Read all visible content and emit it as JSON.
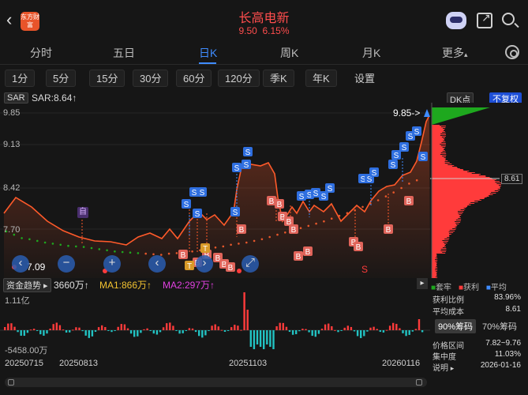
{
  "header": {
    "logo_text": "东方财富",
    "stock_name": "长高电新",
    "price": "9.50",
    "change_pct": "6.15%",
    "icons": [
      "back-arrow-icon",
      "ai-robot-icon",
      "share-icon",
      "search-icon"
    ]
  },
  "tabs": [
    "分时",
    "五日",
    "日K",
    "周K",
    "月K",
    "更多"
  ],
  "active_tab": "日K",
  "periods": [
    "1分",
    "5分",
    "15分",
    "30分",
    "60分",
    "120分",
    "季K",
    "年K",
    "设置"
  ],
  "indicator": {
    "name": "SAR",
    "value_label": "SAR:8.64↑",
    "dk_label": "DK点",
    "adjust_label": "不复权",
    "high_mark": "9.85->",
    "low_mark": "7.09",
    "price_tag": "8.61",
    "y_ticks": [
      "9.85",
      "9.13",
      "8.42",
      "7.70"
    ]
  },
  "colors": {
    "up": "#ff3b3b",
    "down": "#22c3c3",
    "accent": "#3f8cff",
    "sar_up": "#e6572b",
    "sar_down": "#1ea81e"
  },
  "chart_data": {
    "type": "line",
    "title": "SAR",
    "y_range": [
      6.98,
      9.85
    ],
    "series": [
      {
        "name": "SAR",
        "values": [
          7.72,
          7.66,
          7.6,
          7.58,
          7.55,
          7.52,
          7.5,
          7.48,
          7.46,
          7.45,
          7.44,
          7.42,
          7.4,
          7.38,
          7.36,
          7.35,
          7.34,
          7.33,
          7.32,
          7.31,
          7.3,
          7.32,
          7.33,
          7.35,
          7.36,
          7.38,
          7.4,
          7.43,
          7.45,
          7.48,
          7.5,
          7.52,
          7.55,
          7.58,
          7.62,
          7.66,
          7.7,
          7.74,
          7.78,
          7.82,
          7.86,
          7.9,
          7.95,
          8.0,
          8.05,
          8.1,
          8.16,
          8.22,
          8.28,
          8.35,
          8.42,
          8.5,
          8.58,
          8.64
        ]
      }
    ]
  },
  "volume": {
    "indicator": "资金趋势",
    "value": "3660万↑",
    "ma1": "MA1:866万↑",
    "ma2": "MA2:297万↑",
    "top_label": "1.11亿",
    "bottom_label": "-5458.00万"
  },
  "dates": [
    "20250715",
    "20250813",
    "20251103",
    "20260116"
  ],
  "chips": {
    "legend": [
      "套牢",
      "获利",
      "平均"
    ],
    "profit_ratio_label": "获利比例",
    "profit_ratio": "83.96%",
    "avg_cost_label": "平均成本",
    "avg_cost": "8.61",
    "tabs": [
      "90%筹码",
      "70%筹码"
    ],
    "range_label": "价格区间",
    "range": "7.82~9.76",
    "concentration_label": "集中度",
    "concentration": "11.03%",
    "note_label": "说明",
    "date": "2026-01-16"
  },
  "markers": {
    "buy": "B",
    "sell": "S",
    "trade": "T",
    "self": "自"
  }
}
